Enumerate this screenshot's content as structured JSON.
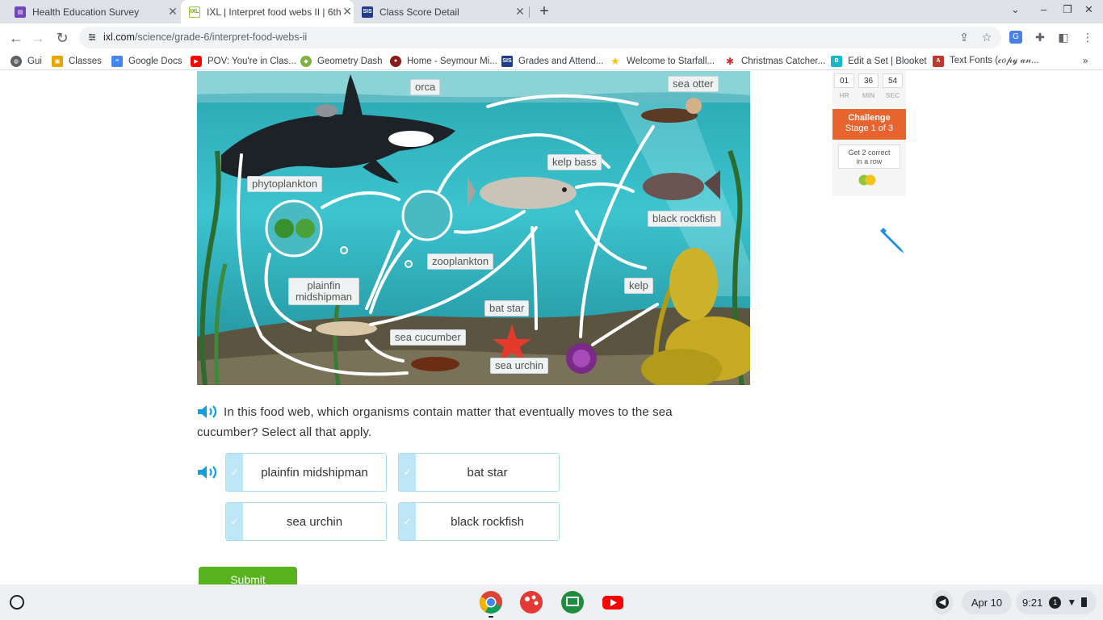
{
  "browser": {
    "tabs": [
      {
        "title": "Health Education Survey",
        "favicon": "forms-icon",
        "active": false
      },
      {
        "title": "IXL | Interpret food webs II | 6th g",
        "favicon": "ixl-icon",
        "active": true
      },
      {
        "title": "Class Score Detail",
        "favicon": "sis-icon",
        "active": false
      }
    ],
    "url_host": "ixl.com",
    "url_path": "/science/grade-6/interpret-food-webs-ii",
    "bookmarks": [
      {
        "label": "Gui"
      },
      {
        "label": "Classes"
      },
      {
        "label": "Google Docs"
      },
      {
        "label": "POV: You're in Clas..."
      },
      {
        "label": "Geometry Dash"
      },
      {
        "label": "Home - Seymour Mi..."
      },
      {
        "label": "Grades and Attend..."
      },
      {
        "label": "Welcome to Starfall..."
      },
      {
        "label": "Christmas Catcher..."
      },
      {
        "label": "Edit a Set | Blooket"
      },
      {
        "label": "Text Fonts (𝒸𝑜𝓅𝓎 𝒶𝓃..."
      }
    ]
  },
  "foodweb": {
    "labels": {
      "orca": "orca",
      "sea_otter": "sea otter",
      "phytoplankton": "phytoplankton",
      "kelp_bass": "kelp bass",
      "black_rockfish": "black rockfish",
      "zooplankton": "zooplankton",
      "plainfin_midshipman": "plainfin midshipman",
      "kelp": "kelp",
      "bat_star": "bat star",
      "sea_cucumber": "sea cucumber",
      "sea_urchin": "sea urchin"
    }
  },
  "question": {
    "text": "In this food web, which organisms contain matter that eventually moves to the sea cucumber? Select all that apply.",
    "answers": [
      "plainfin midshipman",
      "bat star",
      "sea urchin",
      "black rockfish"
    ],
    "submit_label": "Submit"
  },
  "sidebar": {
    "timer": {
      "hr": "01",
      "min": "36",
      "sec": "54",
      "hr_label": "HR",
      "min_label": "MIN",
      "sec_label": "SEC"
    },
    "challenge_title": "Challenge",
    "challenge_stage": "Stage 1 of 3",
    "streak_line1": "Get 2 correct",
    "streak_line2": "in a row"
  },
  "shelf": {
    "date": "Apr 10",
    "time": "9:21",
    "notifications": "1"
  },
  "colors": {
    "ixl_green": "#56b31b",
    "challenge_orange": "#e8642f",
    "answer_border": "#a9dbf0",
    "speaker_blue": "#0fa0e0"
  }
}
